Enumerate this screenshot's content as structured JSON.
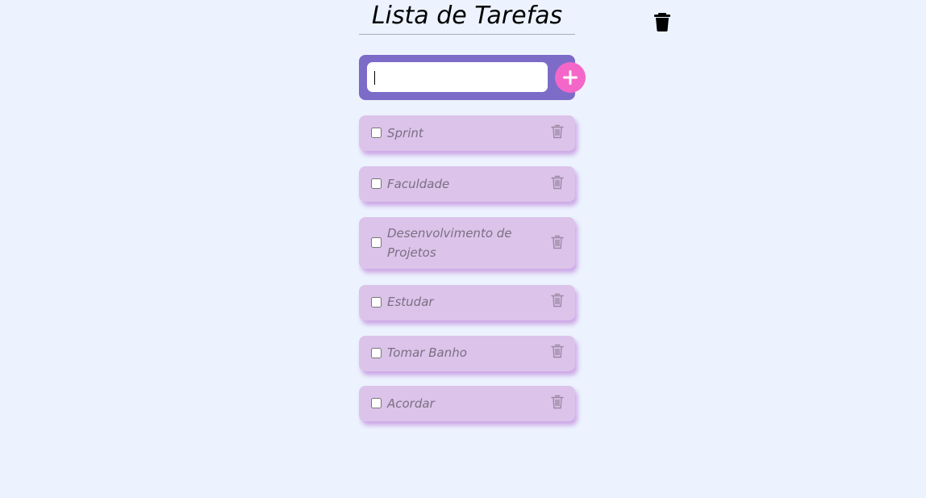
{
  "header": {
    "title": "Lista de Tarefas"
  },
  "input": {
    "value": "",
    "placeholder": ""
  },
  "icons": {
    "clear_all": "trash-icon",
    "add": "plus-icon",
    "delete": "trash-outline-icon"
  },
  "colors": {
    "background": "#ecf3fe",
    "input_bar": "#7c6cc8",
    "add_button": "#f467c8",
    "task_card": "#dcc3ea",
    "task_text": "#7a6f82"
  },
  "tasks": [
    {
      "label": "Sprint",
      "checked": false
    },
    {
      "label": "Faculdade",
      "checked": false
    },
    {
      "label": "Desenvolvimento de Projetos",
      "checked": false
    },
    {
      "label": "Estudar",
      "checked": false
    },
    {
      "label": "Tomar Banho",
      "checked": false
    },
    {
      "label": "Acordar",
      "checked": false
    }
  ]
}
